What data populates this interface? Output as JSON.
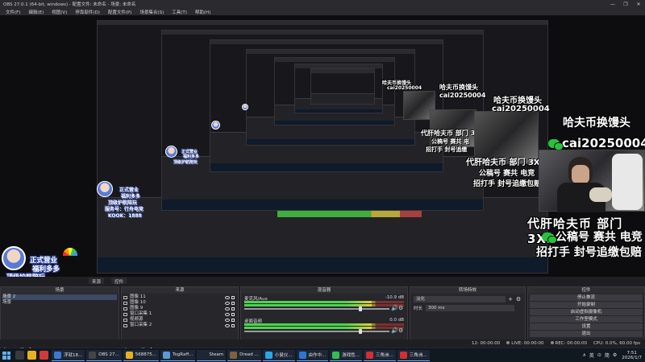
{
  "window": {
    "title": "OBS 27.0.1 (64-bit, windows) - 配置文件: 未命名 - 场景: 未命名",
    "controls": [
      "—",
      "❐",
      "✕"
    ]
  },
  "menu": [
    "文件(F)",
    "编辑(E)",
    "视图(V)",
    "停靠部件(D)",
    "配置文件(P)",
    "场景集合(S)",
    "工具(T)",
    "帮助(H)"
  ],
  "overlay": {
    "header": "哈夫币换馒头",
    "wechat_id": "cai20250004",
    "line1": "代肝哈夫币 部门 3X3",
    "line2": "公稿号 赛共 电竞",
    "line3": "招打手 封号追缴包赔",
    "mid1": {
      "header": "哈夫币换馒头",
      "id": "cai20250004",
      "line1": "代肝哈夫币 部门 3X3",
      "line2": "公稿号 赛共 电竞",
      "line3": "招打手 封号追缴包赔"
    },
    "mid2": {
      "header": "哈夫币换馒头",
      "id": "cai20250004",
      "line1": "代肝哈夫币 部门 3X",
      "line2": "公稿号 赛共 电",
      "line3": "招打手 封号追缴"
    },
    "mid3": {
      "header": "哈夫币换馒头",
      "id": "cai20250004"
    }
  },
  "badge": {
    "line1": "正式营业",
    "line2": "福利多多",
    "line3": "顶级护航陪玩",
    "line4": "服务号：行舟电竞",
    "line5": "KOOK：1888"
  },
  "docks": {
    "tabs": [
      "来源",
      "控件"
    ],
    "scenes": {
      "title": "场景",
      "items": [
        "场景 2",
        "场景"
      ]
    },
    "sources": {
      "title": "来源",
      "items": [
        "图像 11",
        "图像 10",
        "图像 9",
        "窗口采集 1",
        "视频源",
        "窗口采集 2"
      ]
    },
    "mixer": {
      "title": "混音器",
      "channels": [
        {
          "name": "麦克风/Aux",
          "db": "-10.9 dB",
          "level": 0.8
        },
        {
          "name": "桌面音频",
          "db": "0.0 dB",
          "level": 0.8
        }
      ]
    },
    "transitions": {
      "title": "转场特效",
      "selected": "淡化",
      "duration_label": "时长",
      "duration": "300 ms"
    },
    "controls": {
      "title": "控件",
      "buttons": [
        "停止推流",
        "开始录制",
        "启动虚拟摄像机",
        "工作室模式",
        "设置",
        "退出"
      ]
    },
    "footer_icons": [
      "+",
      "−",
      "∧",
      "∨"
    ]
  },
  "status": {
    "live": "LIVE: 00:00:00",
    "rec": "REC: 00:00:00",
    "cpu": "CPU: 0.0%, 60.00 fps",
    "dropped": "12: 00:00:00"
  },
  "taskbar": {
    "items": [
      {
        "label": "浮就18...",
        "color": "#3c78d8"
      },
      {
        "label": "OBS 27...",
        "color": "#444"
      },
      {
        "label": "568875...",
        "color": "#e8b020"
      },
      {
        "label": "TogRaff...",
        "color": "#5a9ad8"
      },
      {
        "label": "Steam",
        "color": "#1b2838"
      },
      {
        "label": "Dread ...",
        "color": "#806040"
      },
      {
        "label": "小鼠仪...",
        "color": "#2aa6e8"
      },
      {
        "label": "由作中...",
        "color": "#2a78d8"
      },
      {
        "label": "游戏性...",
        "color": "#30c050"
      },
      {
        "label": "三角洲...",
        "color": "#d03030"
      },
      {
        "label": "三角洲...",
        "color": "#d03030"
      }
    ],
    "tray": [
      "∧",
      "英",
      "⊙",
      "简",
      "⚙"
    ],
    "time": "7:51",
    "date": "2026/1/7"
  },
  "colors": {
    "panel": "#26262b",
    "accent_green": "#4cd54c",
    "wechat": "#27c13c"
  }
}
